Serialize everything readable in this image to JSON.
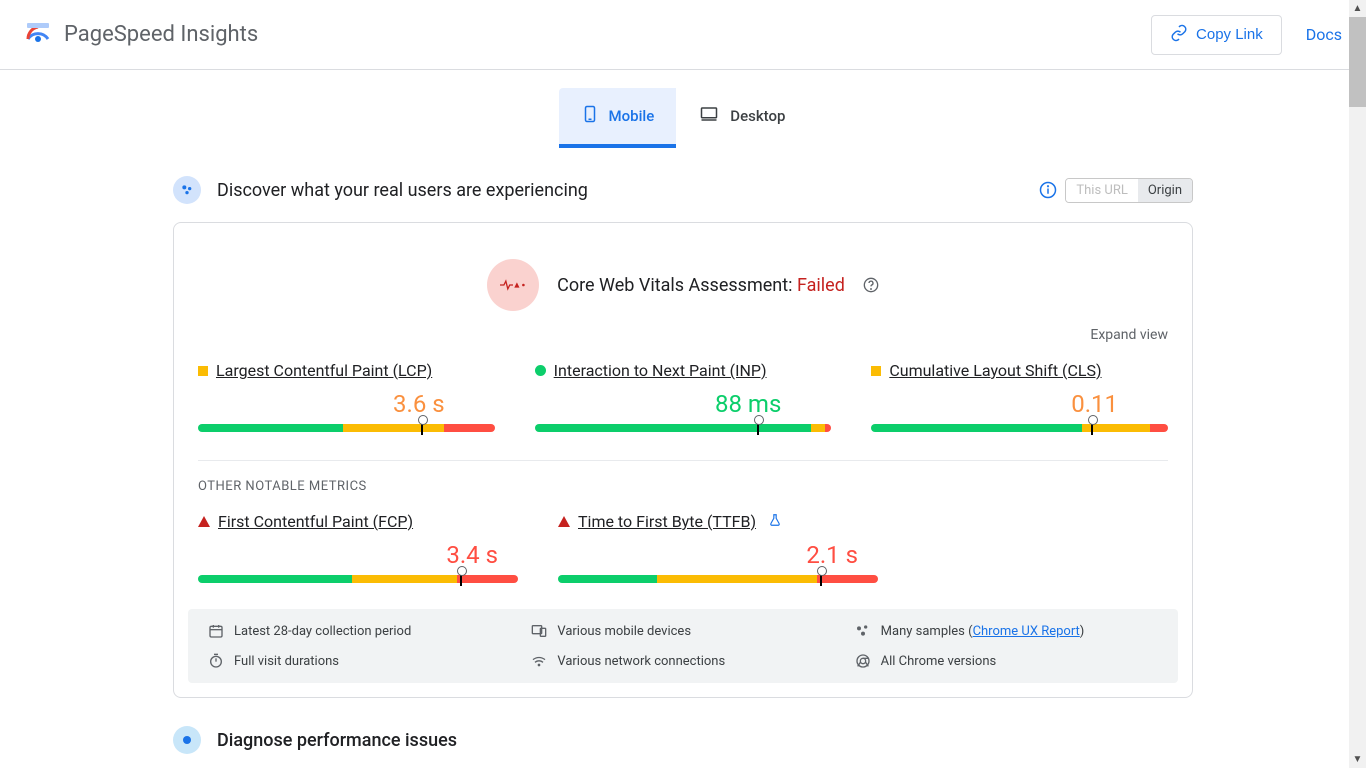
{
  "header": {
    "app_title": "PageSpeed Insights",
    "copy_link": "Copy Link",
    "docs": "Docs"
  },
  "tabs": {
    "mobile": "Mobile",
    "desktop": "Desktop",
    "active": "mobile"
  },
  "section_real_users": {
    "title": "Discover what your real users are experiencing",
    "toggle_this_url": "This URL",
    "toggle_origin": "Origin"
  },
  "cwv": {
    "label": "Core Web Vitals Assessment: ",
    "status": "Failed",
    "expand": "Expand view"
  },
  "metrics": {
    "lcp": {
      "name": "Largest Contentful Paint (LCP)",
      "value": "3.6 s",
      "status": "orange",
      "dist": {
        "g": 49,
        "o": 34,
        "r": 17
      },
      "marker": 75
    },
    "inp": {
      "name": "Interaction to Next Paint (INP)",
      "value": "88 ms",
      "status": "green",
      "dist": {
        "g": 93,
        "o": 5,
        "r": 2
      },
      "marker": 75
    },
    "cls": {
      "name": "Cumulative Layout Shift (CLS)",
      "value": "0.11",
      "status": "orange",
      "dist": {
        "g": 71,
        "o": 23,
        "r": 6
      },
      "marker": 74
    },
    "other_label": "Other Notable Metrics",
    "fcp": {
      "name": "First Contentful Paint (FCP)",
      "value": "3.4 s",
      "status": "red",
      "dist": {
        "g": 48,
        "o": 33,
        "r": 19
      },
      "marker": 82
    },
    "ttfb": {
      "name": "Time to First Byte (TTFB)",
      "value": "2.1 s",
      "status": "red",
      "dist": {
        "g": 31,
        "o": 50,
        "r": 19
      },
      "marker": 82
    }
  },
  "info_box": {
    "period": "Latest 28-day collection period",
    "devices": "Various mobile devices",
    "samples_prefix": "Many samples (",
    "samples_link": "Chrome UX Report",
    "samples_suffix": ")",
    "durations": "Full visit durations",
    "connections": "Various network connections",
    "versions": "All Chrome versions"
  },
  "diagnose": {
    "title": "Diagnose performance issues"
  }
}
